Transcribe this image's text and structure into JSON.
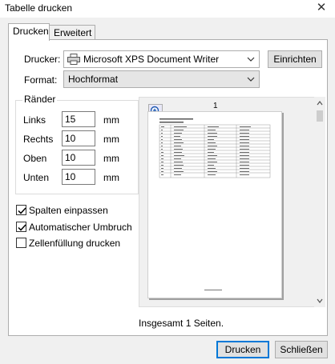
{
  "window": {
    "title": "Tabelle drucken"
  },
  "tabs": [
    {
      "label": "Drucken"
    },
    {
      "label": "Erweitert"
    }
  ],
  "printer": {
    "label": "Drucker:",
    "value": "Microsoft XPS Document Writer",
    "setup_button": "Einrichten"
  },
  "format": {
    "label": "Format:",
    "value": "Hochformat"
  },
  "margins": {
    "title": "Ränder",
    "unit": "mm",
    "left_label": "Links",
    "left_value": "15",
    "right_label": "Rechts",
    "right_value": "10",
    "top_label": "Oben",
    "top_value": "10",
    "bottom_label": "Unten",
    "bottom_value": "10"
  },
  "options": {
    "fit_columns": {
      "label": "Spalten einpassen",
      "checked": true
    },
    "auto_wrap": {
      "label": "Automatischer Umbruch",
      "checked": true
    },
    "cell_fill": {
      "label": "Zellenfüllung drucken",
      "checked": false
    }
  },
  "preview": {
    "page_number": "1",
    "total_text": "Insgesamt 1 Seiten."
  },
  "footer": {
    "print_button": "Drucken",
    "close_button": "Schließen"
  }
}
